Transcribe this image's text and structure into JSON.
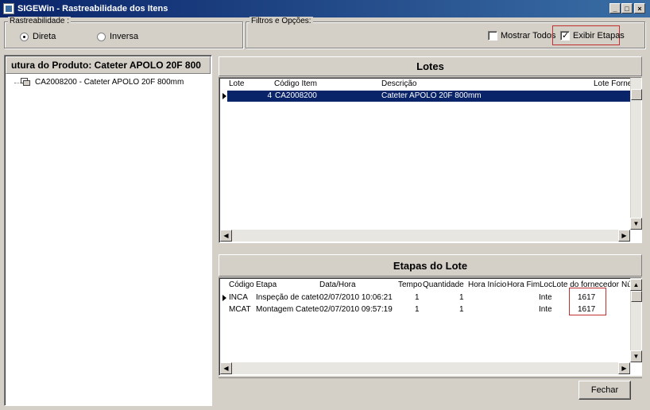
{
  "window": {
    "title": "SIGEWin - Rastreabilidade dos Itens",
    "min": "_",
    "max": "□",
    "close": "×"
  },
  "rastreabilidade": {
    "label": "Rastreabilidade :",
    "options": [
      {
        "label": "Direta",
        "selected": true
      },
      {
        "label": "Inversa",
        "selected": false
      }
    ]
  },
  "filtros": {
    "label": "Filtros e Opções:",
    "mostrar_todos": {
      "label": "Mostrar Todos",
      "checked": false
    },
    "exibir_etapas": {
      "label": "Exibir Etapas",
      "checked": true
    }
  },
  "estrutura": {
    "header": "utura do Produto: Cateter APOLO 20F 800",
    "tree_item": "CA2008200 -  Cateter APOLO 20F 800mm"
  },
  "lotes": {
    "title": "Lotes",
    "columns": [
      "Lote",
      "Código Item",
      "Descrição",
      "Lote Fornec"
    ],
    "rows": [
      {
        "lote": "4",
        "codigo": "CA2008200",
        "descricao": "Cateter APOLO 20F 800mm",
        "lote_fornec": ""
      }
    ]
  },
  "etapas": {
    "title": "Etapas do Lote",
    "columns": [
      "Código",
      "Etapa",
      "Data/Hora",
      "Tempo",
      "Quantidade",
      "Hora Início",
      "Hora Fim",
      "Loc",
      "Lote do fornecedor",
      "Nú"
    ],
    "rows": [
      {
        "codigo": "INCA",
        "etapa": "Inspeção de catete",
        "datahora": "02/07/2010 10:06:21",
        "tempo": "1",
        "quantidade": "1",
        "hora_inicio": "",
        "hora_fim": "",
        "loc": "Inte",
        "lote_fornecedor": "1617"
      },
      {
        "codigo": "MCAT",
        "etapa": "Montagem Cateter",
        "datahora": "02/07/2010 09:57:19",
        "tempo": "1",
        "quantidade": "1",
        "hora_inicio": "",
        "hora_fim": "",
        "loc": "Inte",
        "lote_fornecedor": "1617"
      }
    ]
  },
  "footer": {
    "fechar": "Fechar"
  },
  "icons": {
    "scroll_up": "▲",
    "scroll_down": "▼",
    "scroll_left": "◀",
    "scroll_right": "▶"
  }
}
